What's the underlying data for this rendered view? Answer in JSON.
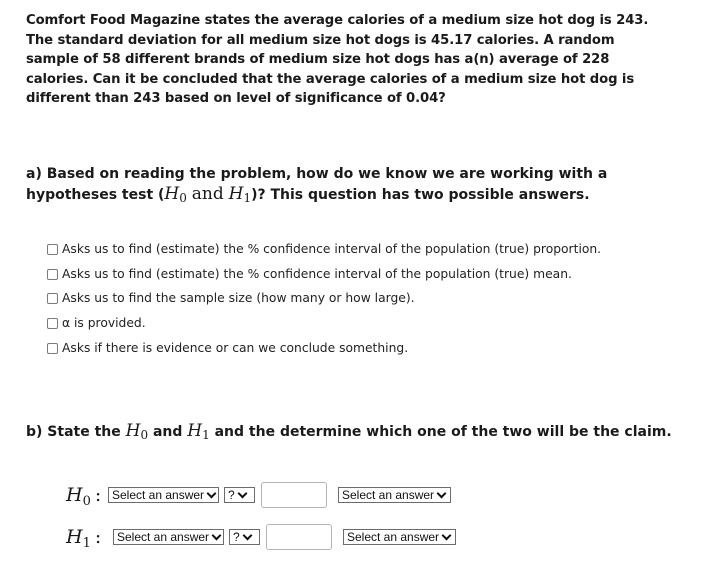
{
  "problem": {
    "text": "Comfort Food Magazine states the average calories of a medium size hot dog is 243. The standard deviation for all medium size hot dogs is 45.17 calories. A random sample of 58 different brands of medium size hot dogs has a(n) average of 228 calories. Can it be concluded that the average calories of a medium size hot dog is different than 243 based on level of significance of 0.04?"
  },
  "part_a": {
    "prefix": "a) Based on reading the problem, how do we know we are working with a hypotheses test (",
    "h0": "H",
    "h0_sub": "0",
    "and_word": "and",
    "h1": "H",
    "h1_sub": "1",
    "suffix": ")? This question has two possible answers.",
    "options": [
      {
        "label": "Asks us to find (estimate) the % confidence interval of the population (true) proportion.",
        "checked": false
      },
      {
        "label": "Asks us to find (estimate) the % confidence interval of the population (true) mean.",
        "checked": false
      },
      {
        "label": "Asks us to find the sample size (how many or how large).",
        "checked": false
      },
      {
        "label": "α is provided.",
        "checked": false
      },
      {
        "label": "Asks if there is evidence or can we conclude something.",
        "checked": false
      }
    ]
  },
  "part_b": {
    "prefix": "b) State the ",
    "h0": "H",
    "h0_sub": "0",
    "middle": " and ",
    "h1": "H",
    "h1_sub": "1",
    "suffix": " and the determine which one of the two will be the claim.",
    "rows": [
      {
        "label": "H",
        "label_sub": "0",
        "colon": ":",
        "parameter_select": "Select an answer",
        "operator_select": "?",
        "value": "",
        "claim_select": "Select an answer"
      },
      {
        "label": "H",
        "label_sub": "1",
        "colon": ":",
        "parameter_select": "Select an answer",
        "operator_select": "?",
        "value": "",
        "claim_select": "Select an answer"
      }
    ]
  }
}
